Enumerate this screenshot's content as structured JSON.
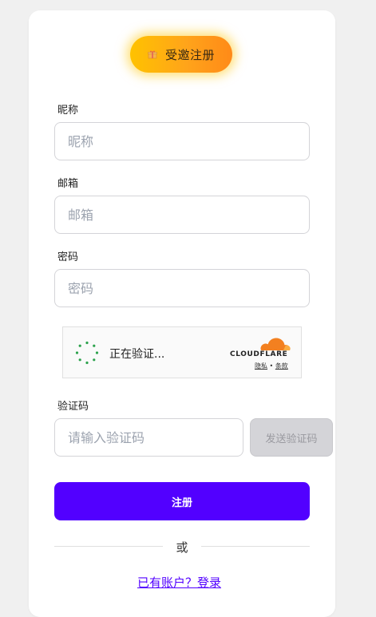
{
  "header": {
    "badge_label": "受邀注册"
  },
  "form": {
    "nickname": {
      "label": "昵称",
      "placeholder": "昵称",
      "value": ""
    },
    "email": {
      "label": "邮箱",
      "placeholder": "邮箱",
      "value": ""
    },
    "password": {
      "label": "密码",
      "placeholder": "密码",
      "value": ""
    },
    "captcha_widget": {
      "status": "正在验证...",
      "brand": "CLOUDFLARE",
      "privacy_link": "隐私",
      "separator": "•",
      "terms_link": "条款"
    },
    "verification_code": {
      "label": "验证码",
      "placeholder": "请输入验证码",
      "value": "",
      "send_button": "发送验证码"
    },
    "submit_label": "注册"
  },
  "divider": {
    "text": "或"
  },
  "footer": {
    "login_link": "已有账户？登录"
  },
  "colors": {
    "primary": "#5200ff",
    "badge_gradient_start": "#ffc200",
    "badge_gradient_end": "#ff8a18",
    "cloudflare_orange": "#f38020",
    "spinner_green": "#2ca24c",
    "disabled_button_bg": "#d4d4d8"
  },
  "icons": {
    "badge": "gift-icon",
    "captcha": "spinner-icon",
    "brand": "cloudflare-cloud-icon"
  }
}
